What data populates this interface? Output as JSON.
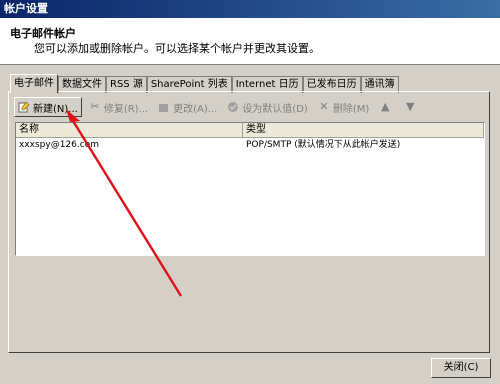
{
  "window": {
    "title": "帐户设置"
  },
  "header": {
    "title": "电子邮件帐户",
    "description": "您可以添加或删除帐户。可以选择某个帐户并更改其设置。"
  },
  "tabs": [
    {
      "label": "电子邮件",
      "active": true
    },
    {
      "label": "数据文件"
    },
    {
      "label": "RSS 源"
    },
    {
      "label": "SharePoint 列表"
    },
    {
      "label": "Internet 日历"
    },
    {
      "label": "已发布日历"
    },
    {
      "label": "通讯簿"
    }
  ],
  "toolbar": {
    "new": {
      "label": "新建(N)...",
      "icon": "new-icon"
    },
    "repair": {
      "label": "修复(R)...",
      "icon": "repair-icon"
    },
    "change": {
      "label": "更改(A)...",
      "icon": "change-icon"
    },
    "default": {
      "label": "设为默认值(D)",
      "icon": "check-circle-icon"
    },
    "remove": {
      "label": "删除(M)",
      "icon": "delete-icon"
    },
    "up": {
      "icon": "arrow-up-icon"
    },
    "down": {
      "icon": "arrow-down-icon"
    }
  },
  "list": {
    "columns": [
      "名称",
      "类型"
    ],
    "rows": [
      {
        "name": "xxxspy@126.com",
        "type": "POP/SMTP (默认情况下从此帐户发送)"
      }
    ]
  },
  "footer": {
    "close_label": "关闭(C)"
  },
  "annotation": {
    "color": "#e0101a"
  }
}
